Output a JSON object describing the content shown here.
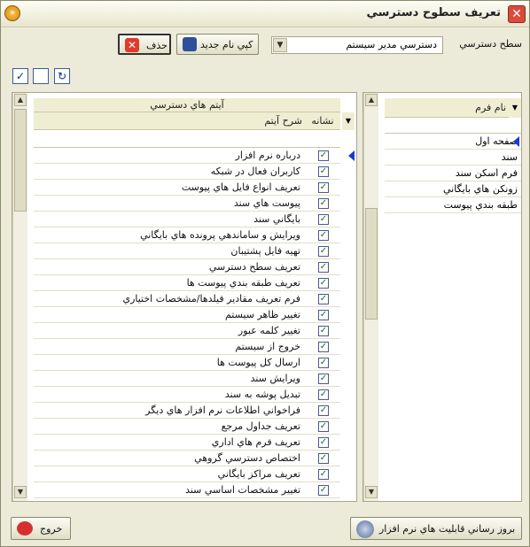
{
  "window": {
    "title": "تعريف سطوح دسترسي",
    "close_glyph": "✕",
    "menu_glyph": "»"
  },
  "access": {
    "label": "سطح دسترسي",
    "value": "دسترسي مدير سيستم"
  },
  "toolbar": {
    "copy_label": "كپي نام جديد",
    "delete_label": "حذف",
    "tool_glyphs": [
      "✓",
      "",
      "↻"
    ]
  },
  "items_panel": {
    "title": "آيتم هاي دسترسي",
    "col_desc": "شرح آيتم",
    "col_mark": "نشانه",
    "check_glyph": "✓",
    "rows": [
      {
        "name": "درباره نرم افزار",
        "checked": true
      },
      {
        "name": "كاربران فعال در شبكه",
        "checked": true
      },
      {
        "name": "تعريف انواع فايل هاي پيوست",
        "checked": true
      },
      {
        "name": "پيوست هاي سند",
        "checked": true
      },
      {
        "name": "بايگاني سند",
        "checked": true
      },
      {
        "name": "ويرايش و ساماندهي پرونده هاي بايگاني",
        "checked": true
      },
      {
        "name": "تهيه فايل پشتيبان",
        "checked": true
      },
      {
        "name": "تعريف سطح دسترسي",
        "checked": true
      },
      {
        "name": "تعريف طبقه بندي پيوست ها",
        "checked": true
      },
      {
        "name": "فرم تعريف مقادير فيلدها/مشخصات اختياري",
        "checked": true
      },
      {
        "name": "تغيير ظاهر سيستم",
        "checked": true
      },
      {
        "name": "تغيير كلمه عبور",
        "checked": true
      },
      {
        "name": "خروج از سيستم",
        "checked": true
      },
      {
        "name": "ارسال كل پيوست ها",
        "checked": true
      },
      {
        "name": "ويرايش سند",
        "checked": true
      },
      {
        "name": "تبديل پوشه به سند",
        "checked": true
      },
      {
        "name": "فراخواني اطلاعات نرم افزار هاي ديگر",
        "checked": true
      },
      {
        "name": "تعريف جداول مرجع",
        "checked": true
      },
      {
        "name": "تعريف فرم هاي اداري",
        "checked": true
      },
      {
        "name": "اختصاص دسترسي گروهي",
        "checked": true
      },
      {
        "name": "تعريف مراكز بايگاني",
        "checked": true
      },
      {
        "name": "تغيير مشخصات اساسي سند",
        "checked": true
      }
    ]
  },
  "forms_panel": {
    "col_name": "نام فرم",
    "rows": [
      {
        "name": "صفحه اول"
      },
      {
        "name": "سند"
      },
      {
        "name": "فرم اسكن سند"
      },
      {
        "name": "زونكن هاي بايگاني"
      },
      {
        "name": "طبقه بندي پيوست"
      }
    ]
  },
  "footer": {
    "exit_label": "خروج",
    "update_label": "بروز رساني قابليت هاي نرم افزار"
  }
}
